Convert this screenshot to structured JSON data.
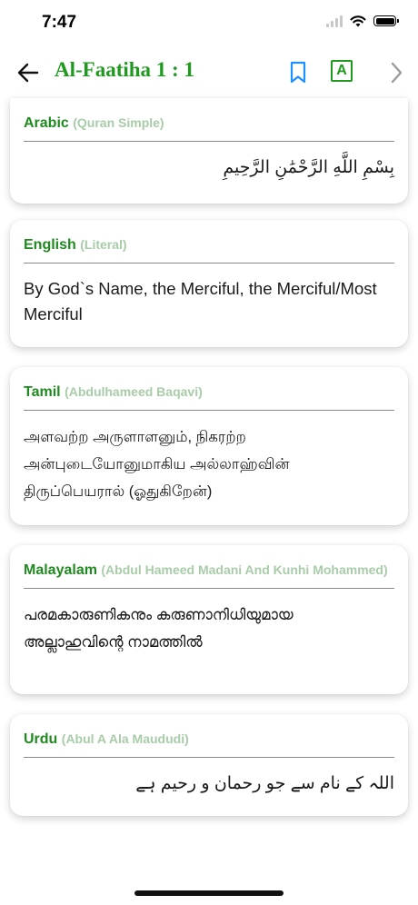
{
  "status": {
    "time": "7:47"
  },
  "nav": {
    "title": "Al-Faatiha 1 : 1",
    "font_button_label": "A"
  },
  "cards": [
    {
      "language": "Arabic",
      "translator": "(Quran Simple)",
      "text": "بِسْمِ اللَّهِ الرَّحْمَٰنِ الرَّحِيمِ"
    },
    {
      "language": "English",
      "translator": "(Literal)",
      "text": "By God`s Name, the Merciful, the Merciful/Most Merciful"
    },
    {
      "language": "Tamil",
      "translator": "(Abdulhameed Baqavi)",
      "text": "அளவற்ற அருளாளனும், நிகரற்ற அன்புடையோனுமாகிய அல்லாஹ்வின் திருப்பெயரால் (ஓதுகிறேன்)"
    },
    {
      "language": "Malayalam",
      "translator": "(Abdul Hameed Madani And Kunhi Mohammed)",
      "text": "പരമകാരുണികനും കരുണാനിധിയുമായ അല്ലാഹുവിന്റെ നാമത്തിൽ"
    },
    {
      "language": "Urdu",
      "translator": "(Abul A Ala Maududi)",
      "text": "اللہ کے نام سے جو رحمان و رحیم ہے"
    }
  ],
  "colors": {
    "accent": "#1f9a1f",
    "translator": "#a8cca8"
  }
}
